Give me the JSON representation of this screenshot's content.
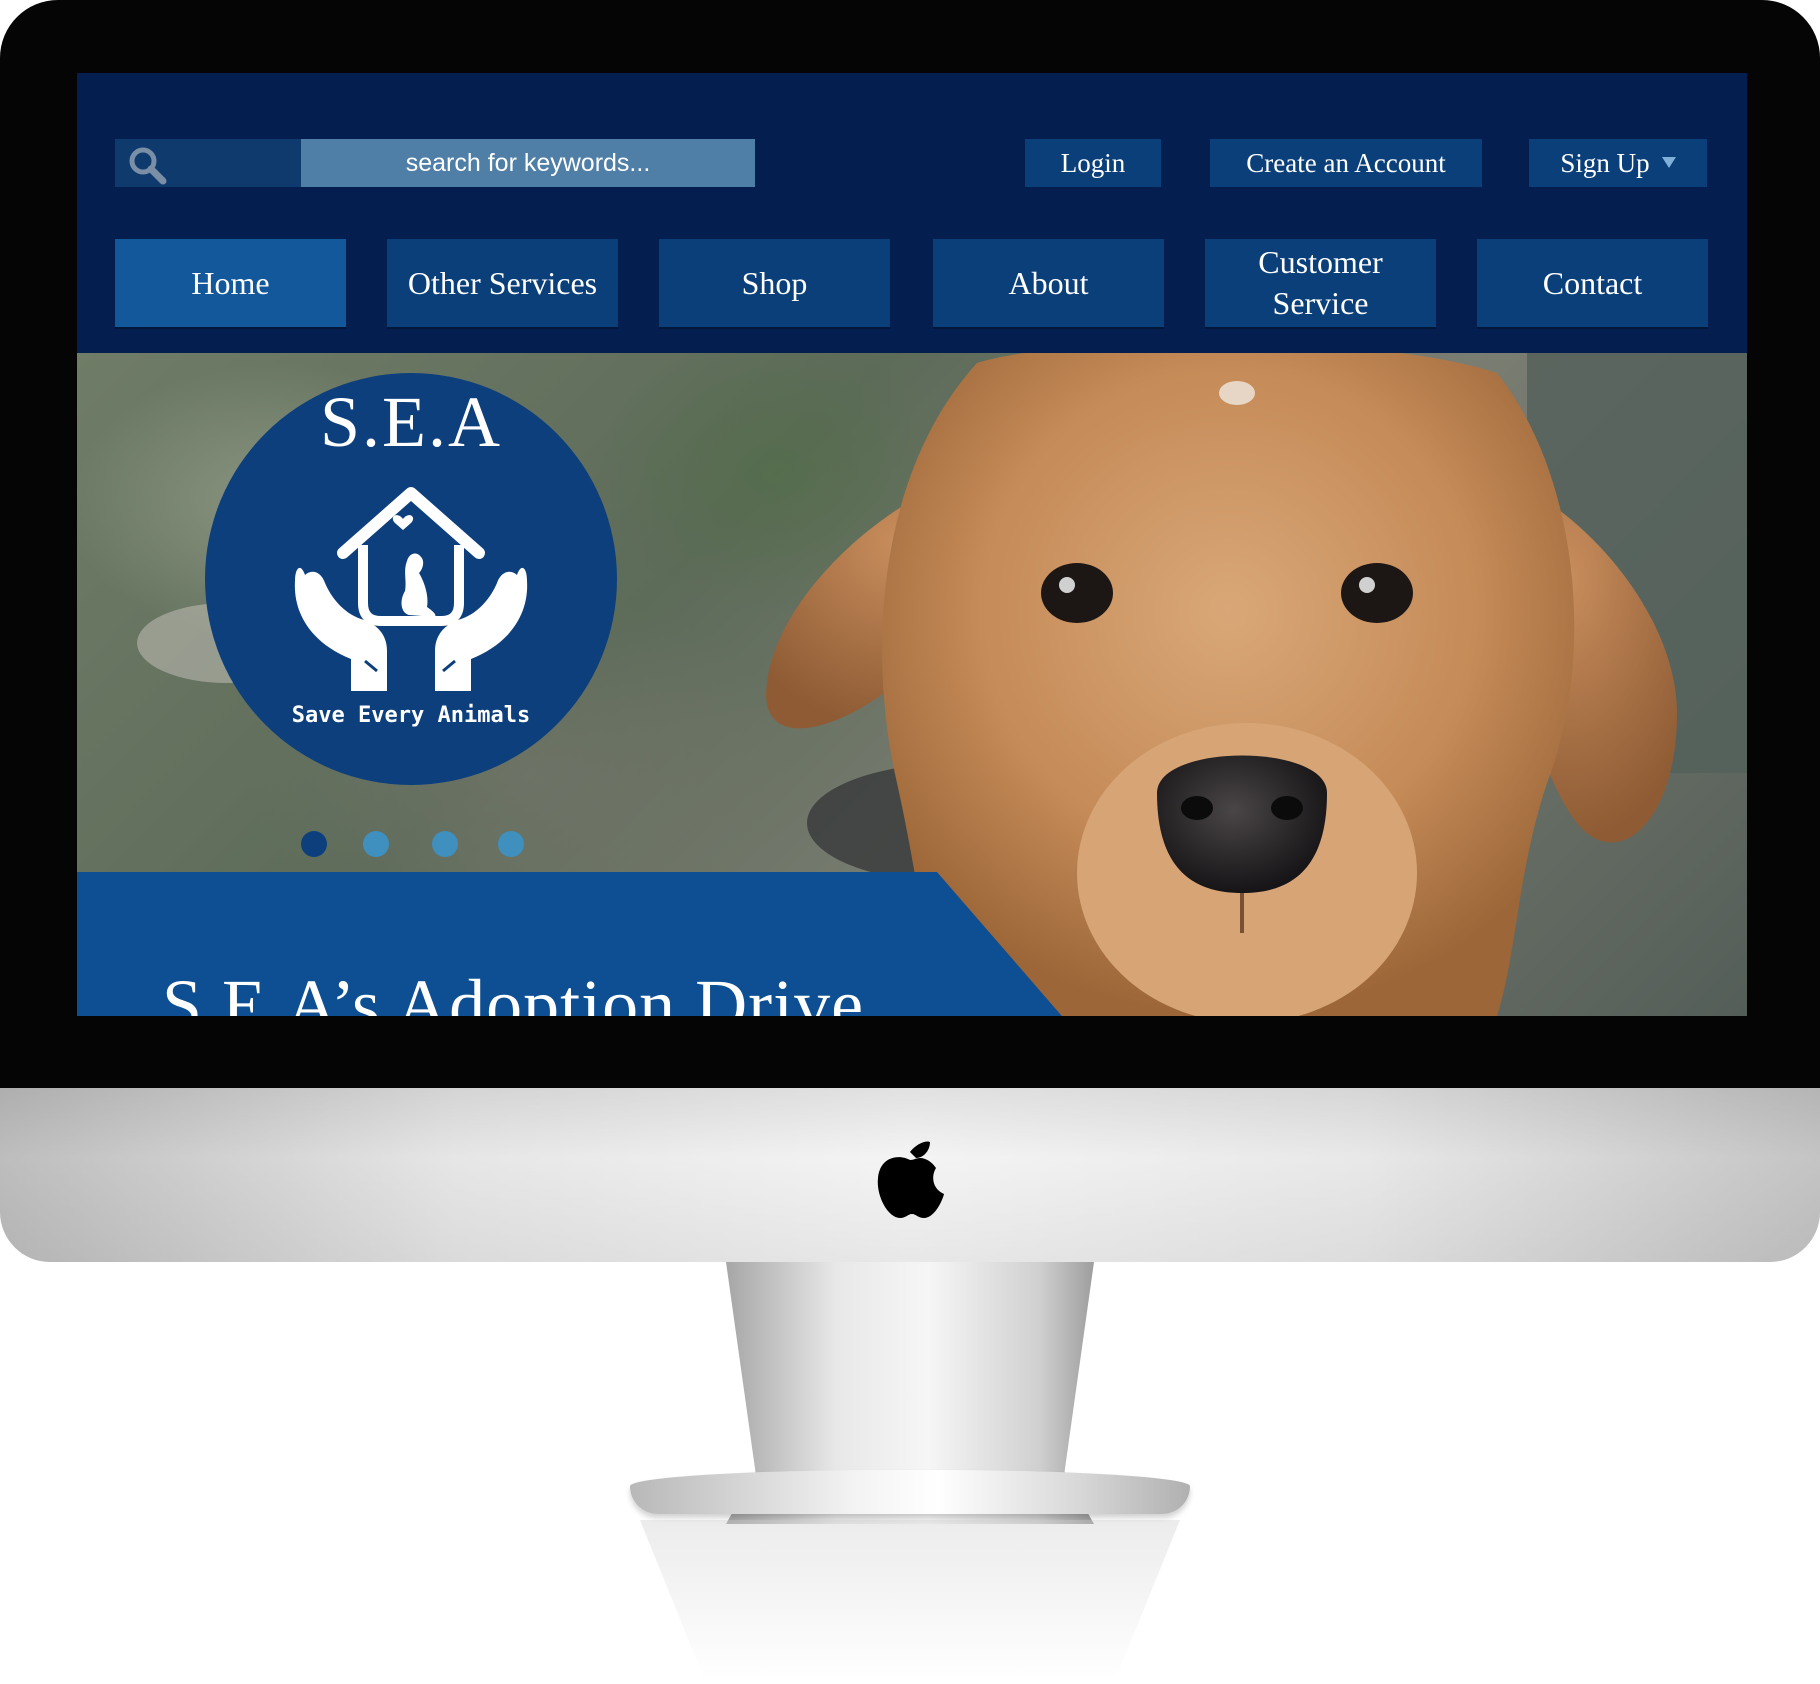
{
  "search": {
    "placeholder": "search for keywords..."
  },
  "account": {
    "login_label": "Login",
    "create_account_label": "Create an Account",
    "sign_up_label": "Sign Up"
  },
  "nav": {
    "tabs": [
      {
        "label": "Home",
        "active": true
      },
      {
        "label": "Other Services",
        "active": false
      },
      {
        "label": "Shop",
        "active": false
      },
      {
        "label": "About",
        "active": false
      },
      {
        "label": "Customer Service",
        "active": false
      },
      {
        "label": "Contact",
        "active": false
      }
    ]
  },
  "hero": {
    "logo": {
      "title": "S.E.A",
      "tagline": "Save Every Animals"
    },
    "slider": {
      "slide_count": 4,
      "active_index": 1
    },
    "banner_title": "S.E.A’s Adoption Drive"
  },
  "colors": {
    "navy": "#041f4f",
    "button_blue": "#0b3f7a",
    "active_blue": "#14589c",
    "logo_blue": "#0d3f7d",
    "dot_inactive": "#3f8fbf"
  },
  "icons": {
    "search": "search-icon",
    "dropdown": "chevron-down-icon",
    "brand": "apple-logo-icon"
  }
}
